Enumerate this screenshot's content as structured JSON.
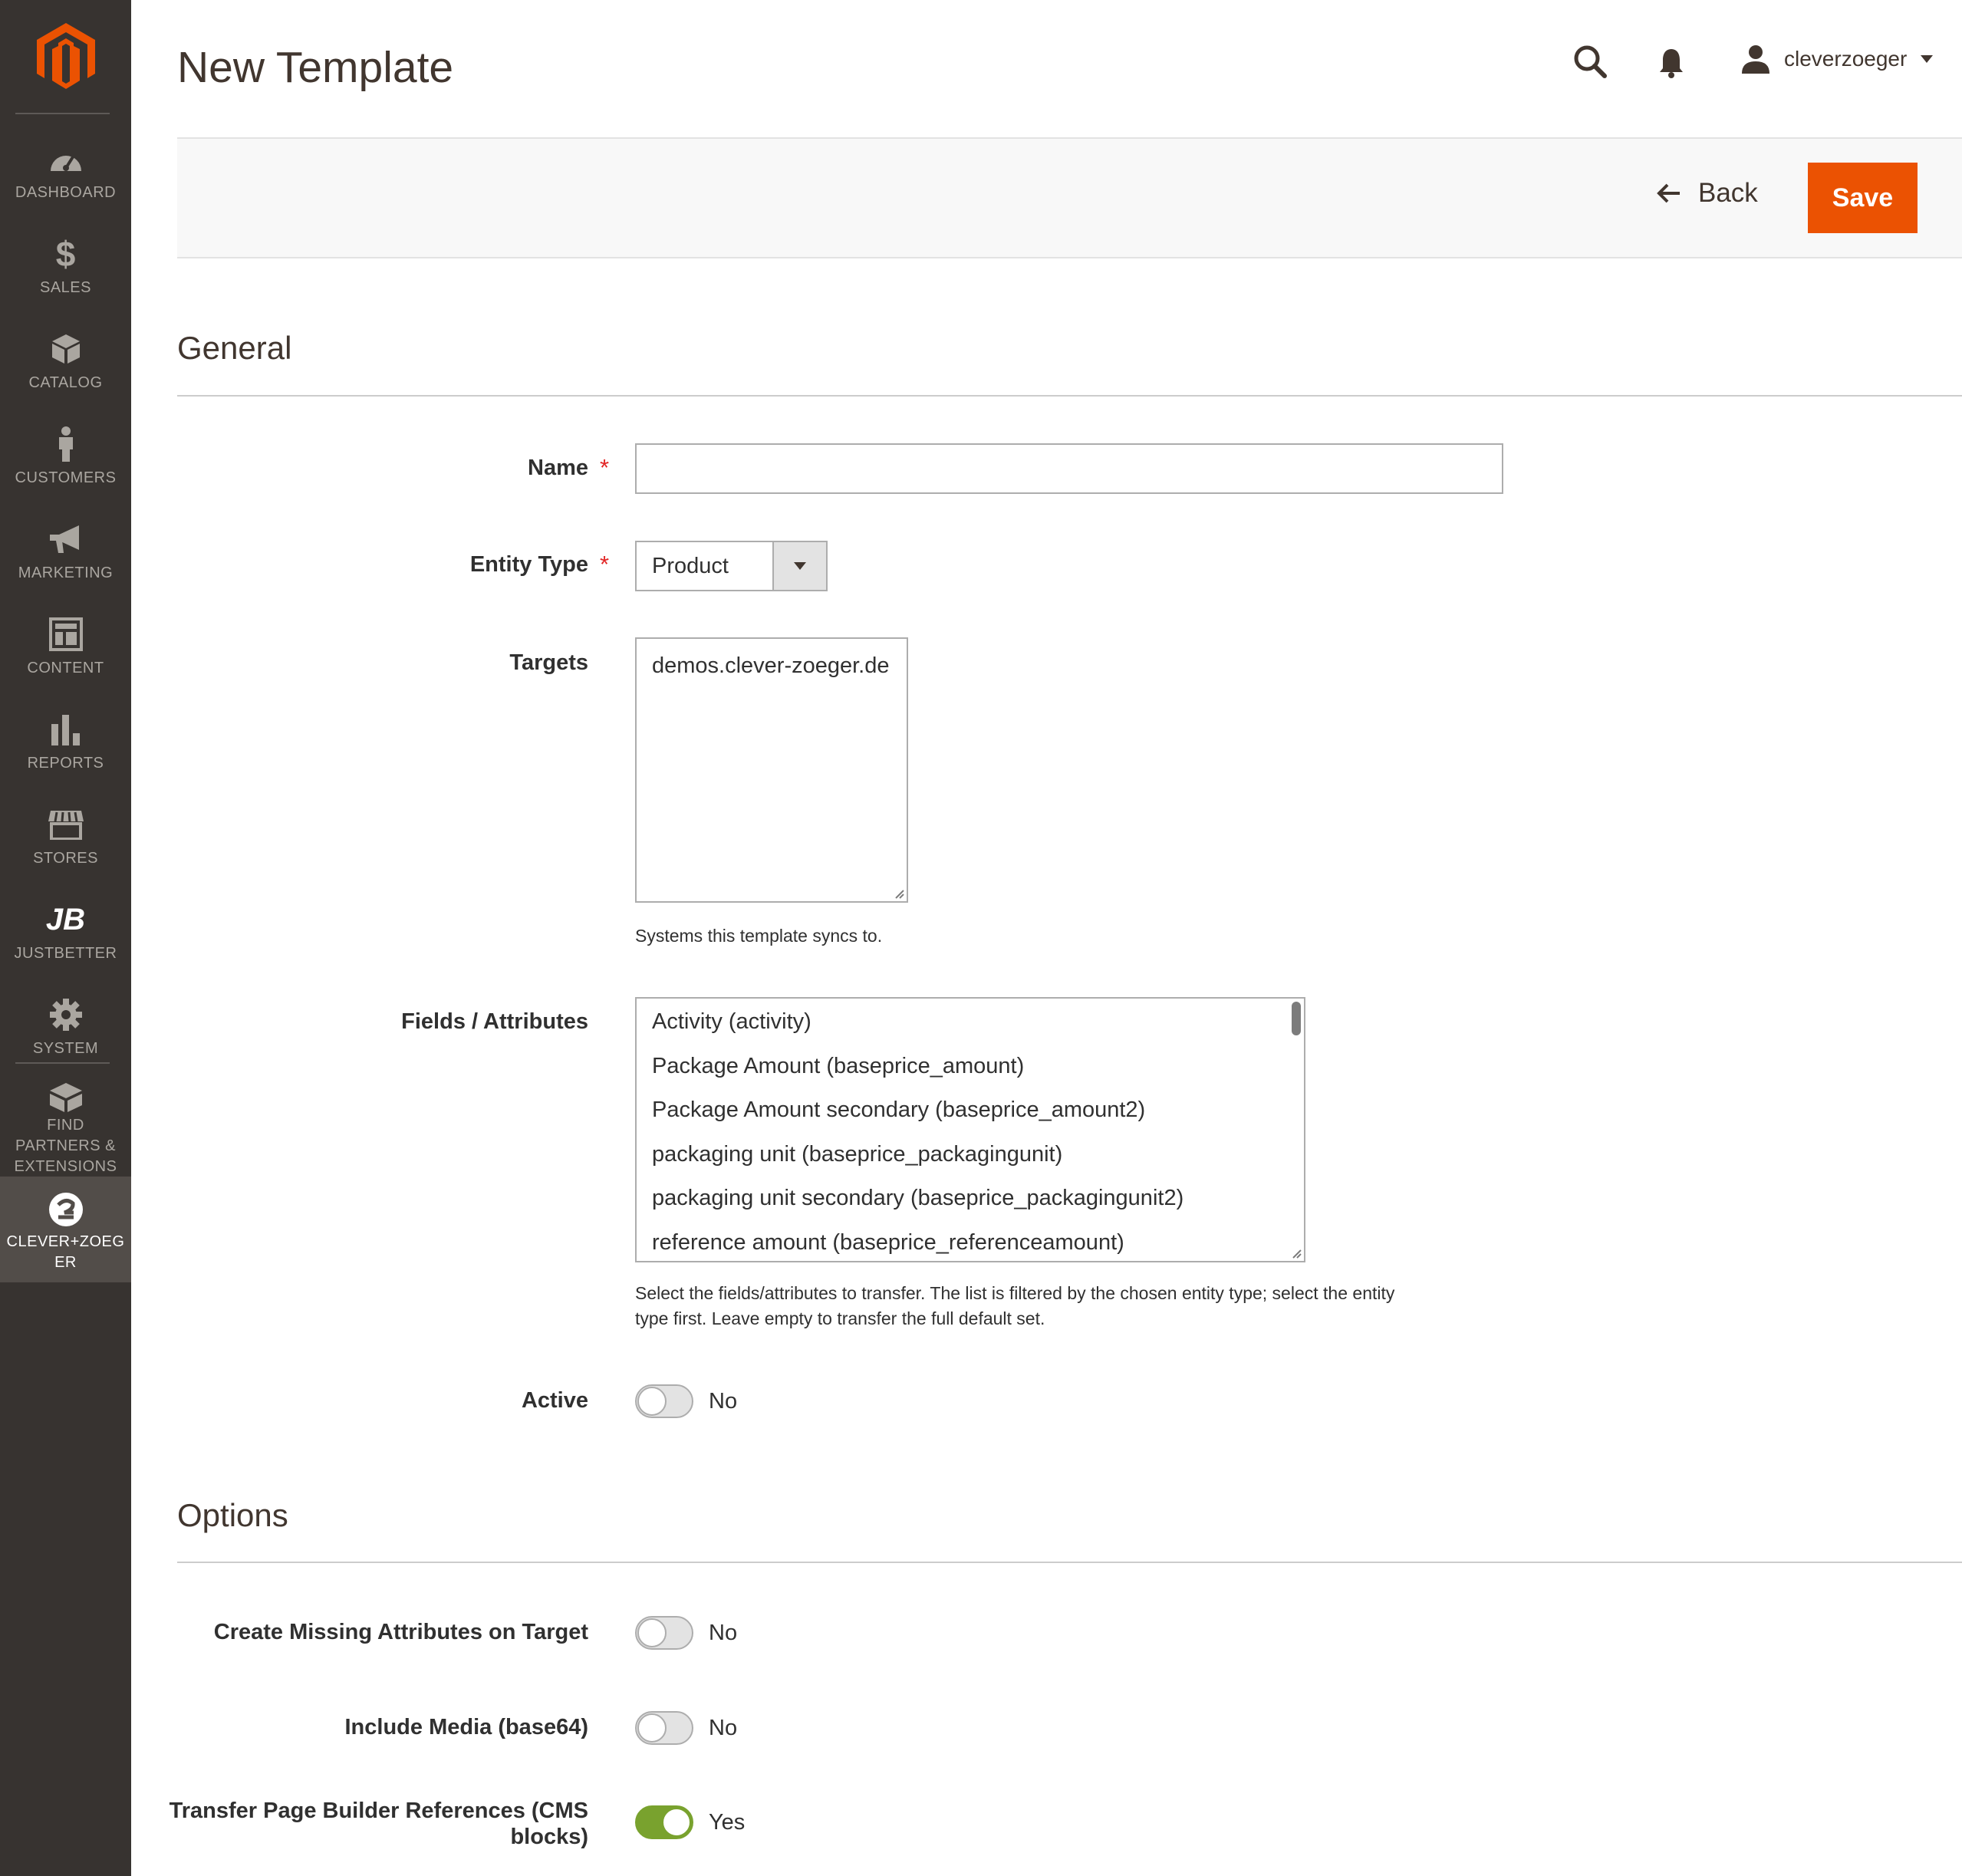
{
  "sidebar": {
    "items": [
      {
        "label": "DASHBOARD",
        "icon": "dashboard-icon"
      },
      {
        "label": "SALES",
        "icon": "dollar-icon"
      },
      {
        "label": "CATALOG",
        "icon": "box-icon"
      },
      {
        "label": "CUSTOMERS",
        "icon": "person-icon"
      },
      {
        "label": "MARKETING",
        "icon": "megaphone-icon"
      },
      {
        "label": "CONTENT",
        "icon": "layout-icon"
      },
      {
        "label": "REPORTS",
        "icon": "bar-chart-icon"
      },
      {
        "label": "STORES",
        "icon": "storefront-icon"
      },
      {
        "label": "JUSTBETTER",
        "icon": "jb-icon"
      },
      {
        "label": "SYSTEM",
        "icon": "gear-icon"
      },
      {
        "label": "FIND PARTNERS & EXTENSIONS",
        "icon": "blocks-icon"
      },
      {
        "label": "CLEVER+ZOEGER",
        "icon": "cz-icon"
      }
    ],
    "brand_color": "#eb5202"
  },
  "header": {
    "title": "New Template",
    "user": "cleverzoeger"
  },
  "actions": {
    "back_label": "Back",
    "save_label": "Save"
  },
  "general": {
    "title": "General",
    "name": {
      "label": "Name",
      "value": "",
      "required_mark": "*"
    },
    "entity_type": {
      "label": "Entity Type",
      "value": "Product",
      "required_mark": "*"
    },
    "targets": {
      "label": "Targets",
      "options": [
        "demos.clever-zoeger.de"
      ],
      "note": "Systems this template syncs to."
    },
    "fields": {
      "label": "Fields / Attributes",
      "options": [
        "Activity (activity)",
        "Package Amount (baseprice_amount)",
        "Package Amount secondary (baseprice_amount2)",
        "packaging unit (baseprice_packagingunit)",
        "packaging unit secondary (baseprice_packagingunit2)",
        "reference amount (baseprice_referenceamount)"
      ],
      "note_line1": "Select the fields/attributes to transfer. The list is filtered by the chosen entity type; select the entity",
      "note_line2": "type first. Leave empty to transfer the full default set."
    },
    "active": {
      "label": "Active",
      "value": "No",
      "on": false
    }
  },
  "options": {
    "title": "Options",
    "create_missing": {
      "label": "Create Missing Attributes on Target",
      "value": "No",
      "on": false
    },
    "include_media": {
      "label": "Include Media (base64)",
      "value": "No",
      "on": false
    },
    "page_builder": {
      "label_line1": "Transfer Page Builder References (CMS",
      "label_line2": "blocks)",
      "value": "Yes",
      "on": true
    }
  },
  "colors": {
    "toggle_on": "#79a22e",
    "save": "#eb5202",
    "sidebar": "#373330"
  }
}
